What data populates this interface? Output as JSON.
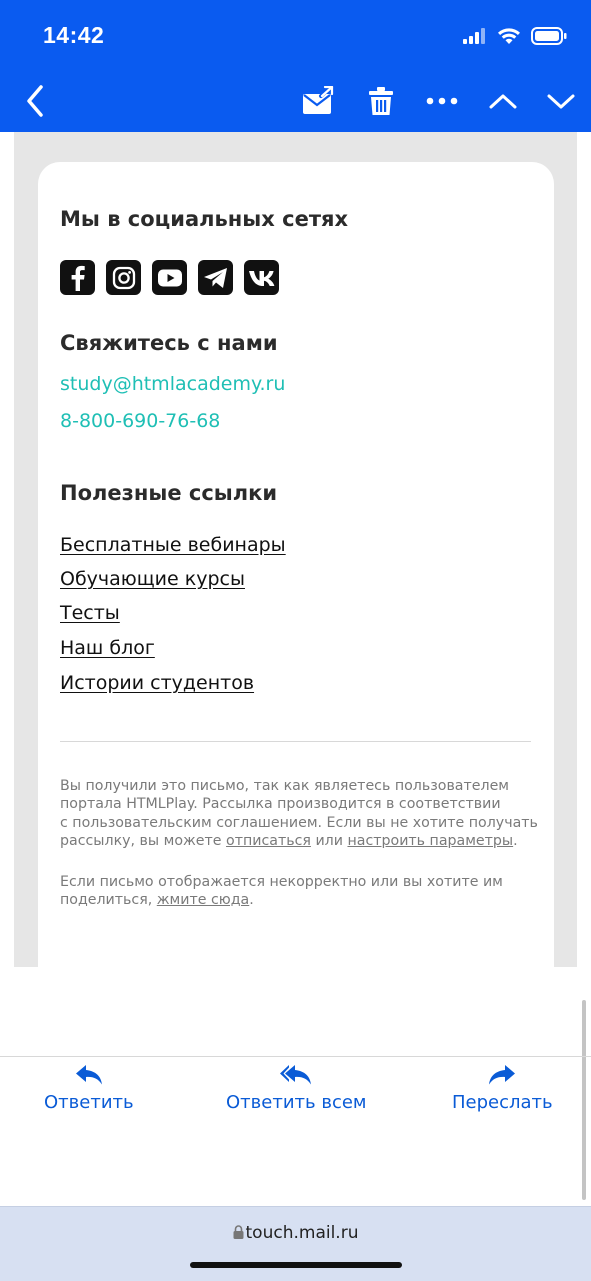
{
  "status": {
    "time": "14:42"
  },
  "toolbar": {
    "icons": [
      "back-icon",
      "move-to-folder-icon",
      "trash-icon",
      "more-icon",
      "chevron-up-icon",
      "chevron-down-icon"
    ]
  },
  "email": {
    "social_heading": "Мы в социальных сетях",
    "social_icons": [
      "facebook-icon",
      "instagram-icon",
      "youtube-icon",
      "telegram-icon",
      "vk-icon"
    ],
    "contact_heading": "Свяжитесь с нами",
    "email": "study@htmlacademy.ru",
    "phone": "8-800-690-76-68",
    "links_heading": "Полезные ссылки",
    "links": [
      "Бесплатные вебинары",
      "Обучающие курсы",
      "Тесты",
      "Наш блог",
      "Истории студентов"
    ],
    "footer": {
      "p1_line1": "Вы получили это письмо, так как являетесь пользователем",
      "p1_line2": "портала HTMLPlay. Рассылка производится в соответствии",
      "p1_line3": "с пользовательским соглашением. Если вы не хотите получать",
      "p1_line4_a": "рассылку, вы можете ",
      "unsubscribe": "отписаться",
      "p1_line4_b": " или ",
      "settings": "настроить параметры",
      "p1_line4_c": ".",
      "p2_line1": "Если письмо отображается некорректно или вы хотите им",
      "p2_line2_a": "поделиться, ",
      "click_here": "жмите сюда",
      "p2_line2_b": "."
    }
  },
  "actions": {
    "reply": "Ответить",
    "reply_all": "Ответить всем",
    "forward": "Переслать"
  },
  "browser": {
    "url": "touch.mail.ru"
  },
  "colors": {
    "accent": "#0a5bf0",
    "link_teal": "#1fbfb5",
    "action_blue": "#0a5bd6"
  }
}
